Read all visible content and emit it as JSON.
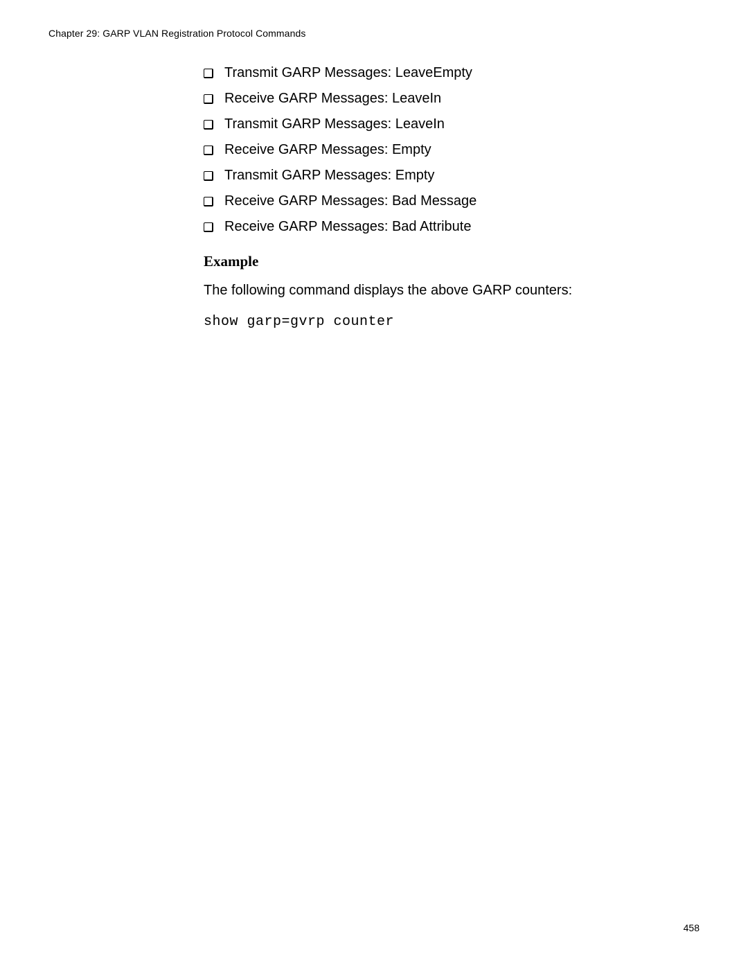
{
  "header": {
    "chapter_line": "Chapter 29: GARP VLAN Registration Protocol Commands"
  },
  "content": {
    "bullets": [
      "Transmit GARP Messages: LeaveEmpty",
      "Receive GARP Messages: LeaveIn",
      "Transmit GARP Messages: LeaveIn",
      "Receive GARP Messages: Empty",
      "Transmit GARP Messages: Empty",
      "Receive GARP Messages: Bad Message",
      "Receive GARP Messages: Bad Attribute"
    ],
    "example_heading": "Example",
    "example_paragraph": "The following command displays the above GARP counters:",
    "example_code": "show garp=gvrp counter"
  },
  "footer": {
    "page_number": "458"
  }
}
